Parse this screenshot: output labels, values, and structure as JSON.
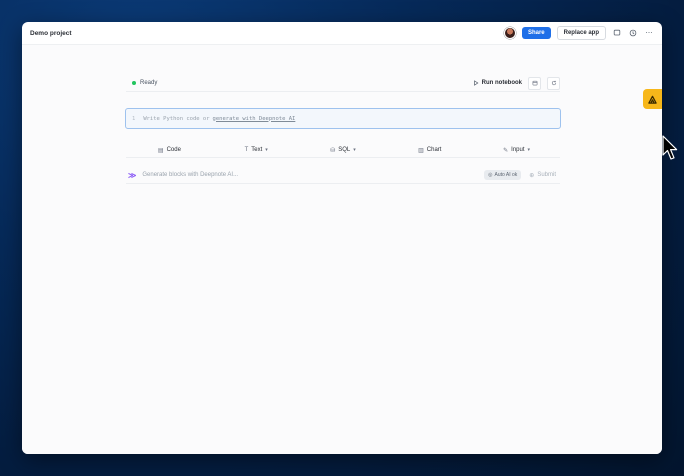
{
  "header": {
    "project_title": "Demo project",
    "share_label": "Share",
    "replace_label": "Replace app"
  },
  "status": {
    "text": "Ready",
    "run_label": "Run notebook"
  },
  "code_cell": {
    "line_number": "1",
    "placeholder_prefix": "Write Python code or",
    "placeholder_link": "generate with Deepnote AI"
  },
  "block_toolbar": {
    "items": [
      {
        "label": "Code",
        "icon": "code-block-icon"
      },
      {
        "label": "Text",
        "icon": "text-block-icon"
      },
      {
        "label": "SQL",
        "icon": "database-icon"
      },
      {
        "label": "Chart",
        "icon": "chart-icon"
      },
      {
        "label": "Input",
        "icon": "pencil-icon"
      }
    ]
  },
  "ai_row": {
    "placeholder": "Generate blocks with Deepnote AI...",
    "badge": "Auto AI ok",
    "submit_label": "Submit"
  },
  "colors": {
    "share_button": "#1e6fe8",
    "status_ready": "#22c55e",
    "deepnote_fab": "#f7b71a",
    "ai_accent": "#8b5cf6"
  }
}
